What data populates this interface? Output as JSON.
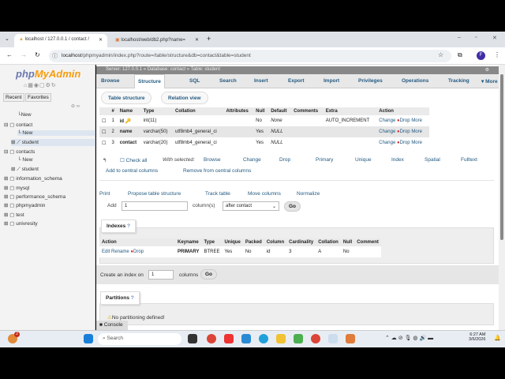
{
  "browser": {
    "tabs": [
      {
        "label": "localhost / 127.0.0.1 / contact /"
      },
      {
        "label": "localhost/web/db2.php?name="
      }
    ],
    "url_host": "localhost",
    "url_path": "/phpmyadmin/index.php?route=/table/structure&db=contact&table=student",
    "profile": "F"
  },
  "sidebar": {
    "logo_a": "php",
    "logo_b": "MyAdmin",
    "recent": "Recent",
    "favorites": "Favorites",
    "tree": [
      "New",
      "contact",
      "New",
      "student",
      "contacts",
      "New",
      "student",
      "information_schema",
      "mysql",
      "performance_schema",
      "phpmyadmin",
      "test",
      "univresity"
    ]
  },
  "breadcrumb": {
    "server": "Server: 127.0.0.1",
    "database": "Database: contact",
    "table": "Table: student"
  },
  "menu": [
    "Browse",
    "Structure",
    "SQL",
    "Search",
    "Insert",
    "Export",
    "Import",
    "Privileges",
    "Operations",
    "Tracking",
    "More"
  ],
  "subtabs": [
    "Table structure",
    "Relation view"
  ],
  "columns": {
    "headers": [
      "#",
      "Name",
      "Type",
      "Collation",
      "Attributes",
      "Null",
      "Default",
      "Comments",
      "Extra",
      "Action"
    ],
    "rows": [
      {
        "num": "1",
        "name": "id",
        "type": "int(11)",
        "collation": "",
        "null": "No",
        "default": "None",
        "extra": "AUTO_INCREMENT"
      },
      {
        "num": "2",
        "name": "name",
        "type": "varchar(50)",
        "collation": "utf8mb4_general_ci",
        "null": "Yes",
        "default": "NULL",
        "extra": ""
      },
      {
        "num": "3",
        "name": "contact",
        "type": "varchar(20)",
        "collation": "utf8mb4_general_ci",
        "null": "Yes",
        "default": "NULL",
        "extra": ""
      }
    ],
    "actions": {
      "change": "Change",
      "drop": "Drop",
      "more": "More"
    }
  },
  "bulk": {
    "check_all": "Check all",
    "with_selected": "With selected:",
    "items": [
      "Browse",
      "Change",
      "Drop",
      "Primary",
      "Unique",
      "Index",
      "Spatial",
      "Fulltext"
    ],
    "add_central": "Add to central columns",
    "remove_central": "Remove from central columns"
  },
  "tools": [
    "Print",
    "Propose table structure",
    "Track table",
    "Move columns",
    "Normalize"
  ],
  "add": {
    "label": "Add",
    "value": "1",
    "columns": "column(s)",
    "position": "after contact",
    "go": "Go"
  },
  "indexes": {
    "legend": "Indexes",
    "headers": [
      "Action",
      "Keyname",
      "Type",
      "Unique",
      "Packed",
      "Column",
      "Cardinality",
      "Collation",
      "Null",
      "Comment"
    ],
    "row": {
      "edit": "Edit",
      "rename": "Rename",
      "drop": "Drop",
      "keyname": "PRIMARY",
      "type": "BTREE",
      "unique": "Yes",
      "packed": "No",
      "column": "id",
      "cardinality": "3",
      "collation": "A",
      "null": "No",
      "comment": ""
    },
    "create_label": "Create an index on",
    "create_value": "1",
    "create_columns": "columns",
    "go": "Go"
  },
  "partitions": {
    "legend": "Partitions",
    "message": "No partitioning defined!"
  },
  "console": "Console",
  "taskbar": {
    "search": "Search",
    "time": "6:27 AM",
    "date": "3/6/2026",
    "badge": "2"
  }
}
